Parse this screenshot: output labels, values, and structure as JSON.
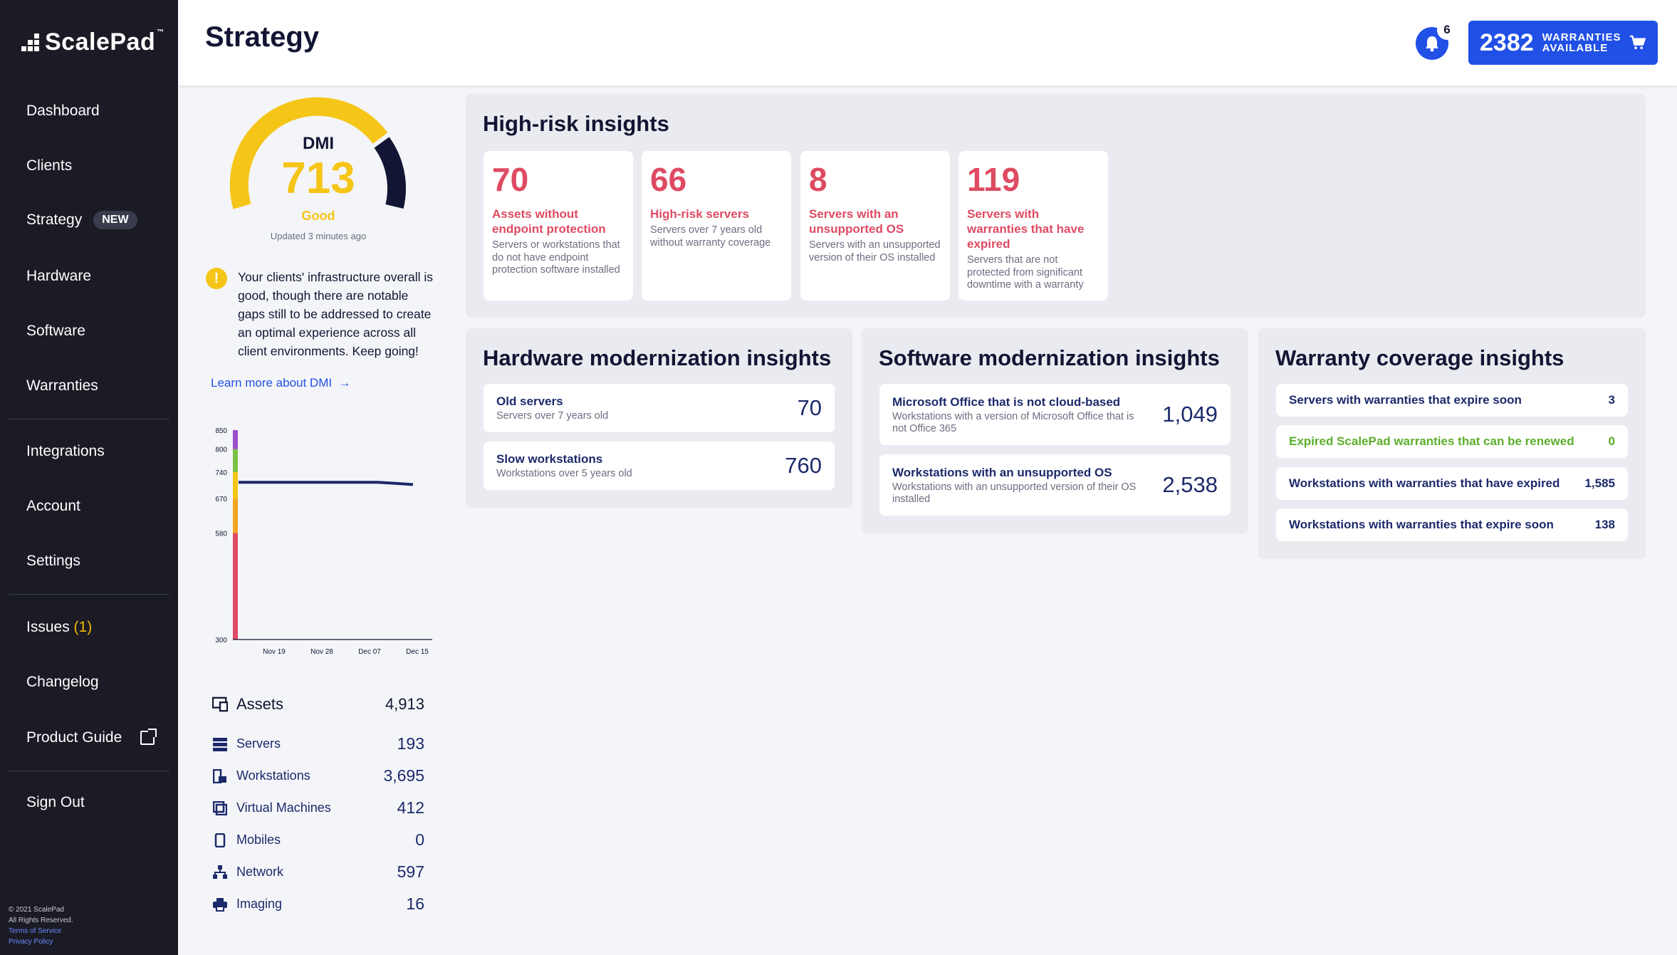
{
  "brand": {
    "name": "ScalePad",
    "tm": "™"
  },
  "sidebar": {
    "items": [
      {
        "label": "Dashboard"
      },
      {
        "label": "Clients"
      },
      {
        "label": "Strategy",
        "badge": "NEW"
      },
      {
        "label": "Hardware"
      },
      {
        "label": "Software"
      },
      {
        "label": "Warranties"
      },
      {
        "label": "Integrations"
      },
      {
        "label": "Account"
      },
      {
        "label": "Settings"
      },
      {
        "label": "Issues",
        "count": "(1)"
      },
      {
        "label": "Changelog"
      },
      {
        "label": "Product Guide"
      },
      {
        "label": "Sign Out"
      }
    ],
    "footer": {
      "copyright": "© 2021 ScalePad",
      "rights": "All Rights Reserved.",
      "terms": "Terms of Service",
      "privacy": "Privacy Policy"
    }
  },
  "header": {
    "title": "Strategy",
    "notifications": "6",
    "warranties_count": "2382",
    "warranties_label_1": "WARRANTIES",
    "warranties_label_2": "AVAILABLE"
  },
  "dmi": {
    "label": "DMI",
    "score": "713",
    "rating": "Good",
    "updated": "Updated 3 minutes ago",
    "notice": "Your clients' infrastructure overall is good, though there are notable gaps still to be addressed to create an optimal experience across all client environments. Keep going!",
    "learn_more": "Learn more about DMI"
  },
  "chart_data": {
    "type": "line",
    "x": [
      "Nov 19",
      "Nov 28",
      "Dec 07",
      "Dec 15"
    ],
    "y_ticks": [
      300,
      580,
      670,
      740,
      800,
      850
    ],
    "ylim": [
      300,
      850
    ],
    "series": [
      {
        "values": [
          713,
          713,
          713,
          713,
          713,
          713,
          713,
          713,
          713,
          710,
          707
        ]
      }
    ],
    "bands": [
      {
        "from": 300,
        "to": 580,
        "color": "#de4b62"
      },
      {
        "from": 580,
        "to": 670,
        "color": "#f5a623"
      },
      {
        "from": 670,
        "to": 740,
        "color": "#f5c518"
      },
      {
        "from": 740,
        "to": 800,
        "color": "#7cc142"
      },
      {
        "from": 800,
        "to": 850,
        "color": "#9b4dca"
      }
    ],
    "line_color": "#1c2a6b"
  },
  "assets": {
    "label": "Assets",
    "total": "4,913",
    "rows": [
      {
        "label": "Servers",
        "value": "193",
        "icon": "server-icon"
      },
      {
        "label": "Workstations",
        "value": "3,695",
        "icon": "workstation-icon"
      },
      {
        "label": "Virtual Machines",
        "value": "412",
        "icon": "vm-icon"
      },
      {
        "label": "Mobiles",
        "value": "0",
        "icon": "mobile-icon"
      },
      {
        "label": "Network",
        "value": "597",
        "icon": "network-icon"
      },
      {
        "label": "Imaging",
        "value": "16",
        "icon": "printer-icon"
      }
    ]
  },
  "high_risk": {
    "title": "High-risk insights",
    "cards": [
      {
        "value": "70",
        "title": "Assets without endpoint protection",
        "desc": "Servers or workstations that do not have endpoint protection software installed"
      },
      {
        "value": "66",
        "title": "High-risk servers",
        "desc": "Servers over 7 years old without warranty coverage"
      },
      {
        "value": "8",
        "title": "Servers with an unsupported OS",
        "desc": "Servers with an unsupported version of their OS installed"
      },
      {
        "value": "119",
        "title": "Servers with warranties that have expired",
        "desc": "Servers that are not protected from significant downtime with a warranty"
      }
    ]
  },
  "hardware": {
    "title": "Hardware modernization insights",
    "rows": [
      {
        "title": "Old servers",
        "sub": "Servers over 7 years old",
        "value": "70"
      },
      {
        "title": "Slow workstations",
        "sub": "Workstations over 5 years old",
        "value": "760"
      }
    ]
  },
  "software": {
    "title": "Software modernization insights",
    "rows": [
      {
        "title": "Microsoft Office that is not cloud-based",
        "sub": "Workstations with a version of Microsoft Office that is not Office 365",
        "value": "1,049"
      },
      {
        "title": "Workstations with an unsupported OS",
        "sub": "Workstations with an unsupported version of their OS installed",
        "value": "2,538"
      }
    ]
  },
  "warranty": {
    "title": "Warranty coverage insights",
    "rows": [
      {
        "title": "Servers with warranties that expire soon",
        "value": "3"
      },
      {
        "title": "Expired ScalePad warranties that can be renewed",
        "value": "0"
      },
      {
        "title": "Workstations with warranties that have expired",
        "value": "1,585"
      },
      {
        "title": "Workstations with warranties that expire soon",
        "value": "138"
      }
    ]
  },
  "colors": {
    "accent": "#2150e6",
    "risk": "#de4b62",
    "gauge_yellow": "#f5c518",
    "gauge_navy": "#121533",
    "green": "#5cae2c"
  }
}
